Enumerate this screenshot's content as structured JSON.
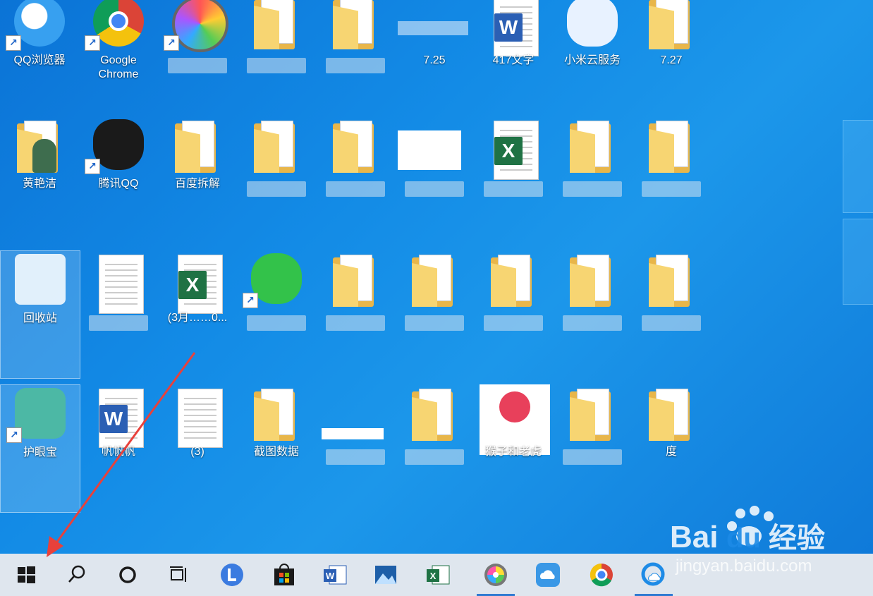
{
  "desktop": {
    "icons": [
      {
        "label": "QQ浏览器",
        "type": "qqbrowser",
        "shortcut": true
      },
      {
        "label": "Google Chrome",
        "type": "chrome",
        "shortcut": true
      },
      {
        "label": "",
        "type": "colorwheel",
        "shortcut": true
      },
      {
        "label": "",
        "type": "folder"
      },
      {
        "label": "",
        "type": "folder"
      },
      {
        "label": "7.25",
        "type": "blurred"
      },
      {
        "label": "417文字",
        "type": "word"
      },
      {
        "label": "小米云服务",
        "type": "cloud"
      },
      {
        "label": "7.27",
        "type": "folder"
      },
      {
        "label": "黄艳洁",
        "type": "userfolder"
      },
      {
        "label": "腾讯QQ",
        "type": "qq",
        "shortcut": true
      },
      {
        "label": "百度拆解",
        "type": "folder"
      },
      {
        "label": "",
        "type": "folder"
      },
      {
        "label": "",
        "type": "folder"
      },
      {
        "label": "",
        "type": "sheetthumb"
      },
      {
        "label": "",
        "type": "excel"
      },
      {
        "label": "",
        "type": "folder"
      },
      {
        "label": "",
        "type": "folder"
      },
      {
        "label": "回收站",
        "type": "recycle",
        "selected": true
      },
      {
        "label": "",
        "type": "doc"
      },
      {
        "label": "(3月……0...",
        "type": "excel"
      },
      {
        "label": "",
        "type": "wechat",
        "shortcut": true
      },
      {
        "label": "",
        "type": "folder"
      },
      {
        "label": "",
        "type": "folder"
      },
      {
        "label": "",
        "type": "folder"
      },
      {
        "label": "",
        "type": "folder"
      },
      {
        "label": "",
        "type": "folder"
      },
      {
        "label": "护眼宝",
        "type": "eye",
        "shortcut": true,
        "selected": true
      },
      {
        "label": "帆帆帆",
        "type": "word"
      },
      {
        "label": "(3)",
        "type": "doc"
      },
      {
        "label": "截图数据",
        "type": "folder"
      },
      {
        "label": "",
        "type": "blank"
      },
      {
        "label": "",
        "type": "folder"
      },
      {
        "label": "猴子和老虎",
        "type": "lizhi"
      },
      {
        "label": "",
        "type": "folder"
      },
      {
        "label": "度",
        "type": "folder"
      }
    ]
  },
  "taskbar": {
    "items": [
      {
        "name": "start-button",
        "icon": "windows-icon"
      },
      {
        "name": "search-button",
        "icon": "search-icon"
      },
      {
        "name": "cortana-button",
        "icon": "cortana-icon"
      },
      {
        "name": "task-view-button",
        "icon": "task-view-icon"
      },
      {
        "name": "app-l",
        "icon": "l-app-icon"
      },
      {
        "name": "store",
        "icon": "store-icon"
      },
      {
        "name": "word",
        "icon": "word-icon"
      },
      {
        "name": "photos",
        "icon": "photos-icon"
      },
      {
        "name": "excel",
        "icon": "excel-icon"
      },
      {
        "name": "colorwheel-app",
        "icon": "colorwheel-icon",
        "active": true
      },
      {
        "name": "cloud-app",
        "icon": "cloud-icon"
      },
      {
        "name": "chrome",
        "icon": "chrome-icon"
      },
      {
        "name": "qqbrowser",
        "icon": "qqbrowser-icon",
        "active": true
      }
    ]
  },
  "watermark": {
    "brand": "Bai",
    "brand2": "du",
    "brand3": "经验",
    "url": "jingyan.baidu.com"
  },
  "colors": {
    "taskbar": "#dfe6ee",
    "desktop": "#138be6",
    "arrow": "#e8413b",
    "active": "#2f7bd2"
  }
}
